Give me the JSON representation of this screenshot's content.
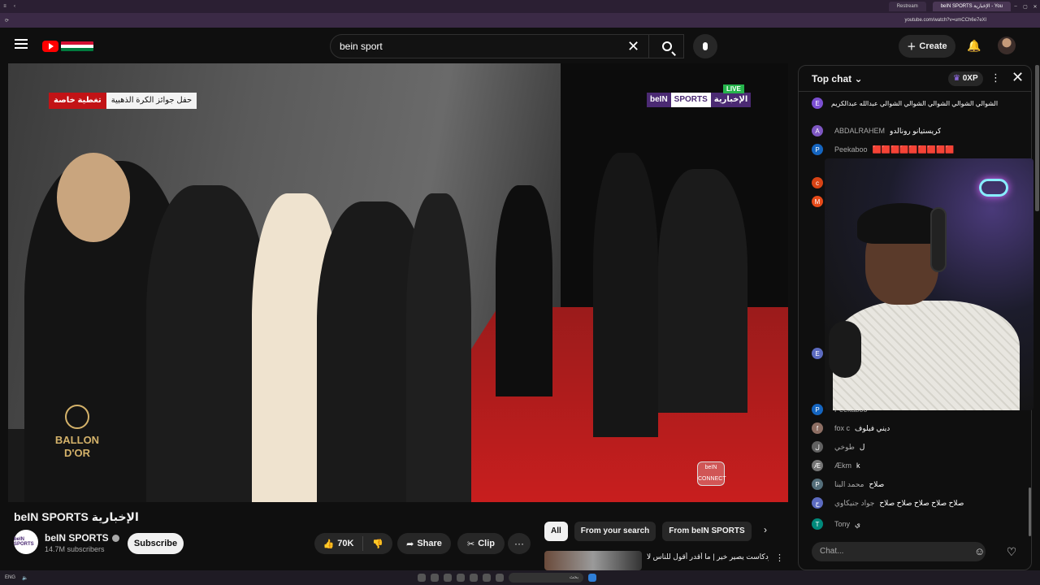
{
  "browser": {
    "tabs": [
      "Restream",
      "beIN SPORTS الإخبارية - You"
    ],
    "url": "youtube.com/watch?v=umCCh6e7eXl"
  },
  "header": {
    "search_value": "bein sport",
    "create_label": "Create"
  },
  "video": {
    "overlay_white": "حفل جوائز الكرة الذهبية",
    "overlay_red": "تغطية خاصة",
    "logo_bein": "beIN",
    "logo_sports": "SPORTS",
    "logo_news": "الإخبارية",
    "live_label": "LIVE",
    "ballon_line1": "BALLON",
    "ballon_line2": "D'OR",
    "connect_line1": "beIN",
    "connect_line2": "CONNECT"
  },
  "info": {
    "title": "beIN SPORTS الإخبارية",
    "channel_avatar": "beIN SPORTS",
    "channel_name": "beIN SPORTS",
    "subscribers": "14.7M subscribers",
    "subscribe_label": "Subscribe",
    "likes": "70K",
    "share_label": "Share",
    "clip_label": "Clip",
    "more_label": "···"
  },
  "chips": {
    "items": [
      "All",
      "From your search",
      "From beIN SPORTS"
    ]
  },
  "recommendation": {
    "title": "بودكاست يصير خير | ما أقدر أقول للناس لا"
  },
  "chat": {
    "header_title": "Top chat",
    "xp_value": "0XP",
    "input_placeholder": "Chat...",
    "messages": [
      {
        "initial": "E",
        "color": "#7b4fd1",
        "name": "",
        "text": "الشوالي الشوالي الشوالي الشوالي الشوالي  عبدالله عبدالكريم"
      },
      {
        "initial": "A",
        "color": "#7e57c2",
        "name": "ABDALRAHEM",
        "text": "كريستيانو رونالدو"
      },
      {
        "initial": "P",
        "color": "#1565c0",
        "name": "Peekaboo",
        "text": "🟥🟥🟥🟥🟥🟥🟥🟥🟥"
      },
      {
        "initial": "c",
        "color": "#d84315",
        "name": "",
        "text": ""
      },
      {
        "initial": "M",
        "color": "#e64a19",
        "name": "",
        "text": ""
      },
      {
        "initial": "E",
        "color": "#5c6bc0",
        "name": "",
        "text": ""
      },
      {
        "initial": "P",
        "color": "#1565c0",
        "name": "Peekaboo",
        "text": ""
      },
      {
        "initial": "f",
        "color": "#8d6e63",
        "name": "fox c",
        "text": "ديني فيلوف"
      },
      {
        "initial": "ل",
        "color": "#616161",
        "name": "طوخي",
        "text": "ل"
      },
      {
        "initial": "Æ",
        "color": "#757575",
        "name": "Ækm",
        "text": "k"
      },
      {
        "initial": "P",
        "color": "#546e7a",
        "name": "محمد البنا",
        "text": "صلاح"
      },
      {
        "initial": "ج",
        "color": "#5c6bc0",
        "name": "جواد جنيكاوي",
        "text": "صلاح صلاح صلاح صلاح صلاح"
      },
      {
        "initial": "T",
        "color": "#00897b",
        "name": "Tony",
        "text": "ي"
      }
    ]
  },
  "taskbar": {
    "lang": "ENG",
    "search_placeholder": "بحث"
  }
}
